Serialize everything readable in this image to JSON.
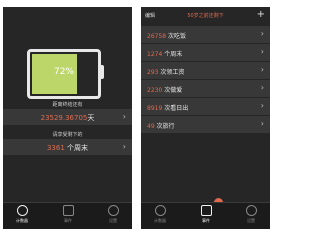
{
  "left": {
    "battery_percent": 72,
    "battery_label": "72%",
    "caption1": "距离终结还有",
    "days_value": "23529.36705",
    "days_unit": "天",
    "caption2": "请享受剩下的",
    "weekends_value": "3361",
    "weekends_unit": " 个周末",
    "tabs": [
      {
        "label": "计数器",
        "active": true
      },
      {
        "label": "事件",
        "active": false
      },
      {
        "label": "设置",
        "active": false
      }
    ]
  },
  "right": {
    "nav_edit": "编辑",
    "nav_title": "50岁之前还剩下",
    "nav_add": "+",
    "rows": [
      {
        "num": "26758",
        "text": " 次吃饭"
      },
      {
        "num": "1274",
        "text": " 个周末"
      },
      {
        "num": "293",
        "text": " 次领工资"
      },
      {
        "num": "2230",
        "text": " 次做爱"
      },
      {
        "num": "8919",
        "text": " 次看日出"
      },
      {
        "num": "49",
        "text": " 次旅行"
      }
    ],
    "slider_percent": 62,
    "tabs": [
      {
        "label": "计数器",
        "active": false
      },
      {
        "label": "事件",
        "active": true
      },
      {
        "label": "设置",
        "active": false
      }
    ]
  },
  "colors": {
    "accent": "#e06a4e",
    "battery": "#bdd66a",
    "bg": "#262626",
    "row": "#383838"
  },
  "icons": {
    "chevron": "chevron-right-icon",
    "tab1": "clock-icon",
    "tab2": "grid-icon",
    "tab3": "gear-icon"
  }
}
